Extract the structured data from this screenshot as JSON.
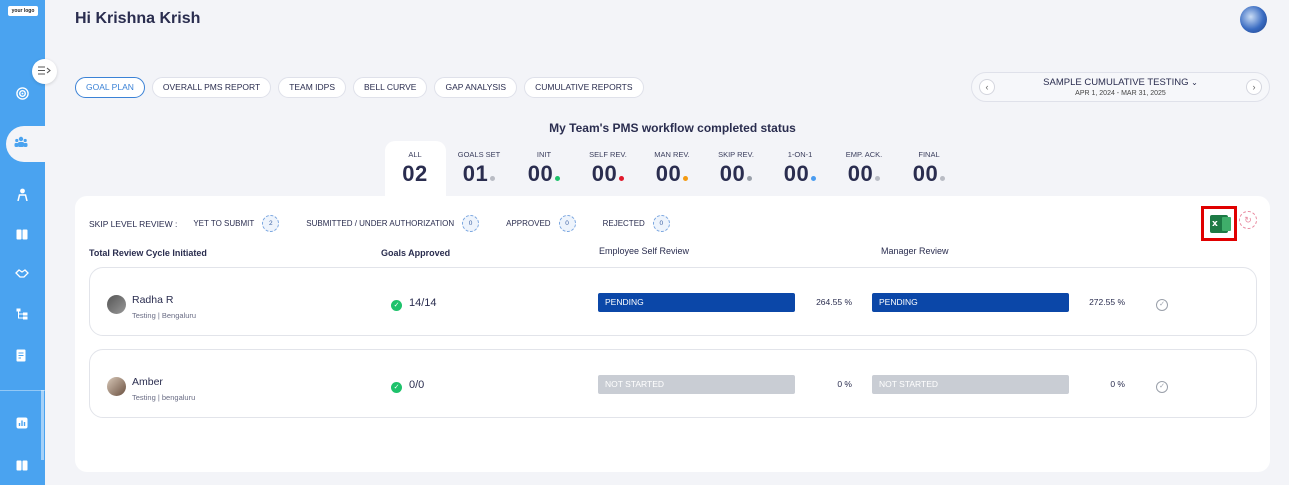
{
  "sidebar": {
    "logo_text": "your logo",
    "icons": [
      "target-icon",
      "team-icon",
      "person-icon",
      "book-icon",
      "handshake-icon",
      "hierarchy-icon",
      "document-edit-icon",
      "report-icon",
      "book-icon"
    ]
  },
  "header": {
    "greeting": "Hi Krishna Krish"
  },
  "tabs": [
    {
      "label": "GOAL PLAN",
      "active": true
    },
    {
      "label": "OVERALL PMS REPORT"
    },
    {
      "label": "TEAM IDPS"
    },
    {
      "label": "BELL CURVE"
    },
    {
      "label": "GAP ANALYSIS"
    },
    {
      "label": "CUMULATIVE REPORTS"
    }
  ],
  "cycle": {
    "name": "SAMPLE CUMULATIVE TESTING",
    "range": "APR 1, 2024 - MAR 31, 2025"
  },
  "status": {
    "title": "My Team's PMS workflow completed status",
    "counters": [
      {
        "label": "ALL",
        "value": "02",
        "dot": null
      },
      {
        "label": "GOALS SET",
        "value": "01",
        "dot": "#b9bcc4"
      },
      {
        "label": "INIT",
        "value": "00",
        "dot": "#1ec26b"
      },
      {
        "label": "SELF REV.",
        "value": "00",
        "dot": "#e0192b"
      },
      {
        "label": "MAN REV.",
        "value": "00",
        "dot": "#f39a12"
      },
      {
        "label": "SKIP REV.",
        "value": "00",
        "dot": "#9aa0aa"
      },
      {
        "label": "1-ON-1",
        "value": "00",
        "dot": "#4a9cf0"
      },
      {
        "label": "EMP. ACK.",
        "value": "00",
        "dot": "#b9bcc4"
      },
      {
        "label": "FINAL",
        "value": "00",
        "dot": "#b9bcc4"
      }
    ]
  },
  "skip_level": {
    "label": "SKIP LEVEL REVIEW :",
    "items": [
      {
        "label": "YET TO SUBMIT",
        "count": "2"
      },
      {
        "label": "SUBMITTED / UNDER AUTHORIZATION",
        "count": "0"
      },
      {
        "label": "APPROVED",
        "count": "0"
      },
      {
        "label": "REJECTED",
        "count": "0"
      }
    ]
  },
  "table": {
    "headers": {
      "cycle": "Total Review Cycle Initiated",
      "goals": "Goals Approved",
      "self": "Employee Self Review",
      "manager": "Manager Review"
    },
    "rows": [
      {
        "name": "Radha R",
        "meta": "Testing | Bengaluru",
        "goals": "14/14",
        "self_status": "PENDING",
        "self_pct": "264.55 %",
        "manager_status": "PENDING",
        "manager_pct": "272.55 %"
      },
      {
        "name": "Amber",
        "meta": "Testing | bengaluru",
        "goals": "0/0",
        "self_status": "NOT STARTED",
        "self_pct": "0 %",
        "manager_status": "NOT STARTED",
        "manager_pct": "0 %"
      }
    ]
  }
}
